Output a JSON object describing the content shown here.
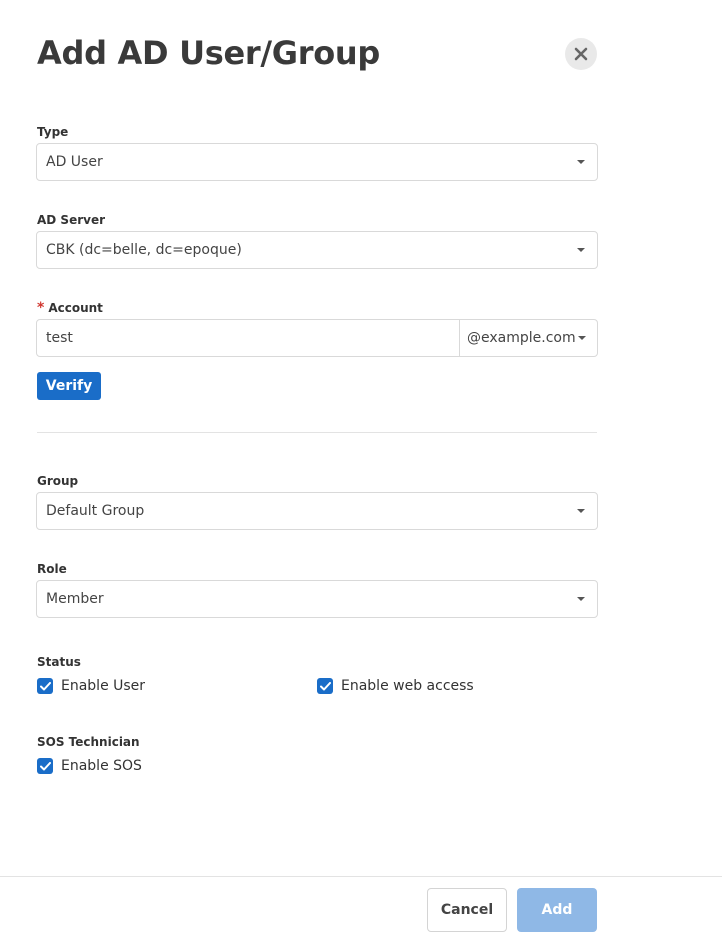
{
  "dialog": {
    "title": "Add AD User/Group"
  },
  "form": {
    "type": {
      "label": "Type",
      "value": "AD User"
    },
    "ad_server": {
      "label": "AD Server",
      "value": "CBK (dc=belle, dc=epoque)"
    },
    "account": {
      "required_mark": "*",
      "label": "Account",
      "value": "test",
      "domain": "@example.com"
    },
    "verify_label": "Verify",
    "group": {
      "label": "Group",
      "value": "Default Group"
    },
    "role": {
      "label": "Role",
      "value": "Member"
    },
    "status": {
      "label": "Status",
      "enable_user": {
        "label": "Enable User",
        "checked": true
      },
      "enable_web_access": {
        "label": "Enable web access",
        "checked": true
      }
    },
    "sos": {
      "label": "SOS Technician",
      "enable_sos": {
        "label": "Enable SOS",
        "checked": true
      }
    }
  },
  "footer": {
    "cancel_label": "Cancel",
    "add_label": "Add"
  },
  "colors": {
    "primary": "#1a6dc8",
    "primary_disabled": "#8fb8e6",
    "required": "#d0362f"
  },
  "icons": {
    "close": "close-icon",
    "caret": "chevron-down-icon",
    "check": "check-icon"
  }
}
